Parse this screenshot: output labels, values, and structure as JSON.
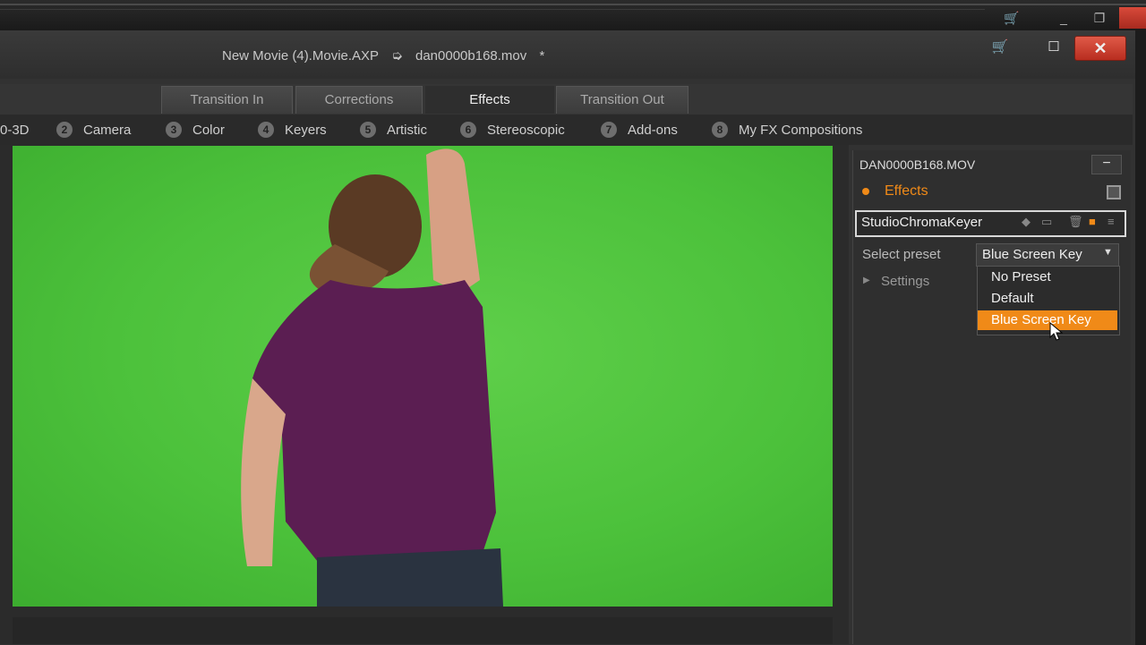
{
  "window": {
    "title_project": "New Movie (4).Movie.AXP",
    "title_arrow": "➭",
    "title_clip": "dan0000b168.mov",
    "title_modified": "*",
    "close_glyph": "✕",
    "maximize_glyph": "☐",
    "cart_glyph": "🛒"
  },
  "tabs": [
    {
      "label": "Transition In"
    },
    {
      "label": "Corrections"
    },
    {
      "label": "Effects",
      "active": true
    },
    {
      "label": "Transition Out"
    }
  ],
  "categories": [
    {
      "num": "",
      "label": "0-3D"
    },
    {
      "num": "2",
      "label": "Camera"
    },
    {
      "num": "3",
      "label": "Color"
    },
    {
      "num": "4",
      "label": "Keyers"
    },
    {
      "num": "5",
      "label": "Artistic"
    },
    {
      "num": "6",
      "label": "Stereoscopic"
    },
    {
      "num": "7",
      "label": "Add-ons"
    },
    {
      "num": "8",
      "label": "My FX Compositions"
    }
  ],
  "panel": {
    "clip_name": "DAN0000B168.MOV",
    "minus_glyph": "−",
    "effects_label": "Effects",
    "effect_name": "StudioChromaKeyer",
    "select_preset_label": "Select preset",
    "selected_preset": "Blue Screen Key",
    "settings_label": "Settings",
    "preset_options": [
      "No Preset",
      "Default",
      "Blue Screen Key"
    ]
  },
  "colors": {
    "accent": "#f08a18",
    "chroma_green": "#4cc13b"
  }
}
